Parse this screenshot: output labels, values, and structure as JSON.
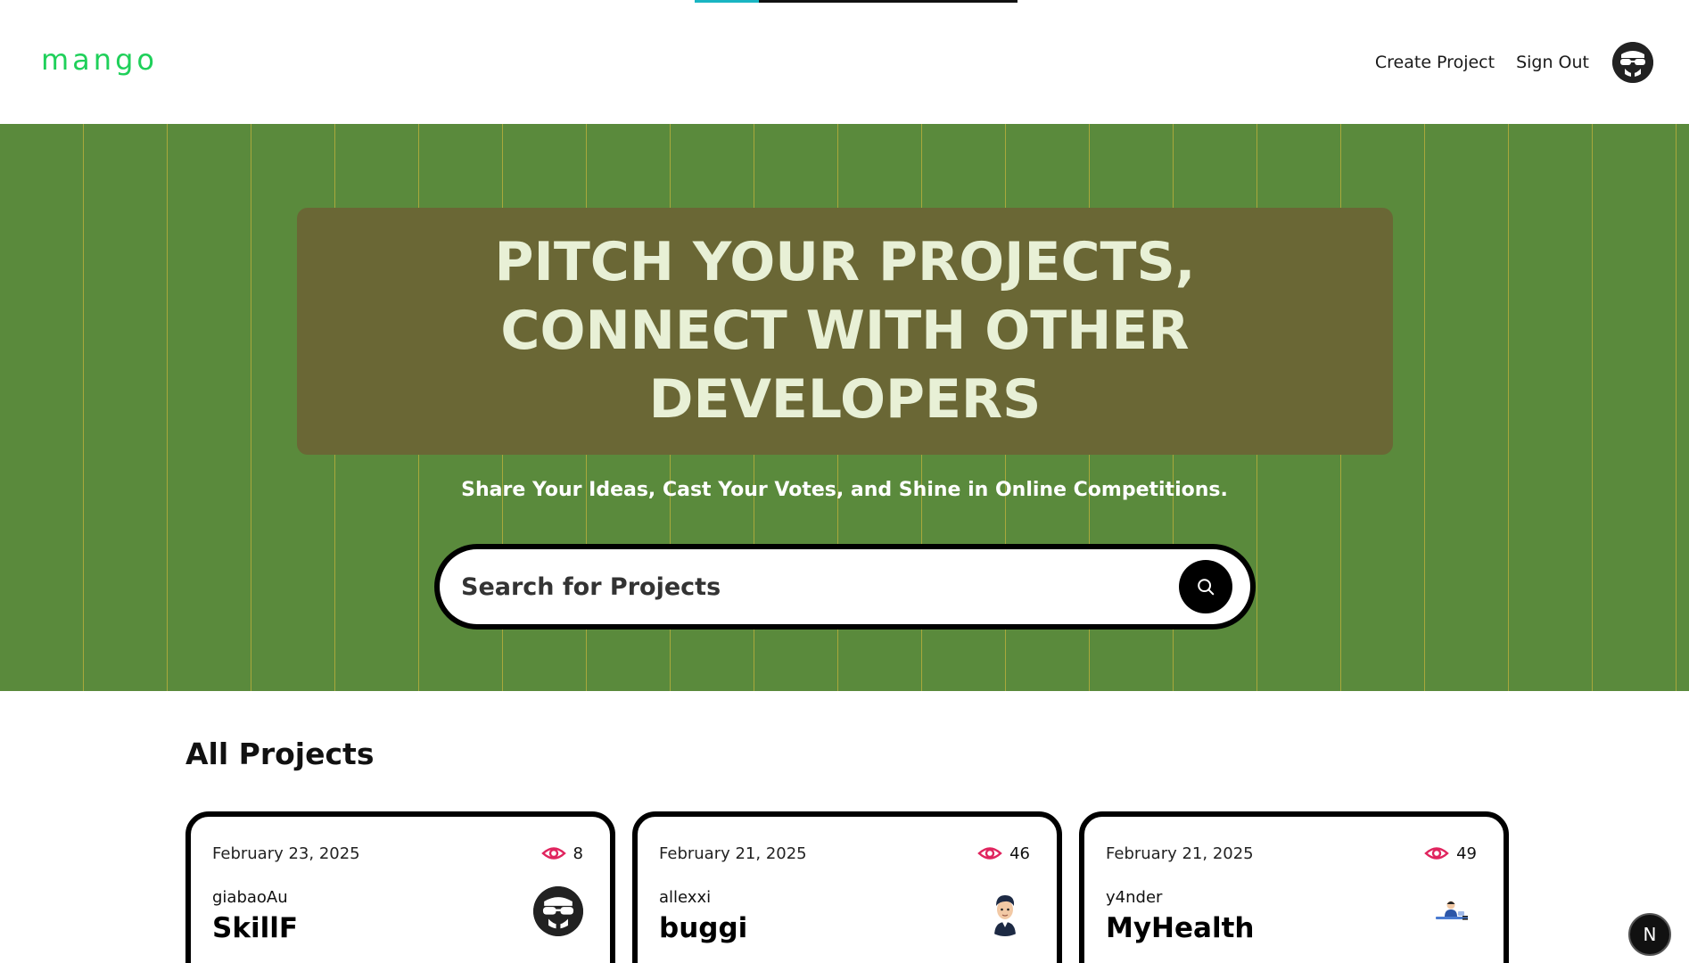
{
  "progress": {
    "fraction": 0.2
  },
  "header": {
    "logo": "mango",
    "nav": {
      "create_project": "Create Project",
      "sign_out": "Sign Out"
    }
  },
  "hero": {
    "title": "PITCH YOUR PROJECTS, CONNECT WITH OTHER DEVELOPERS",
    "subtitle": "Share Your Ideas, Cast Your Votes, and Shine in Online Competitions.",
    "search_placeholder": "Search for Projects"
  },
  "projects": {
    "title": "All Projects",
    "cards": [
      {
        "date": "February 23, 2025",
        "views": "8",
        "author": "giabaoAu",
        "name": "SkillF",
        "avatar_icon": "hacker-avatar-icon"
      },
      {
        "date": "February 21, 2025",
        "views": "46",
        "author": "allexxi",
        "name": "buggi",
        "avatar_icon": "person-avatar-icon"
      },
      {
        "date": "February 21, 2025",
        "views": "49",
        "author": "y4nder",
        "name": "MyHealth",
        "avatar_icon": "developer-avatar-icon"
      }
    ]
  },
  "badge": {
    "letter": "N"
  },
  "colors": {
    "logo": "#1fd05a",
    "hero_bg": "#5a8a3c",
    "hero_box": "#6a6735",
    "hero_text": "#e8f0d6",
    "eye_icon": "#e0245e",
    "progress": "#19b5c2"
  }
}
